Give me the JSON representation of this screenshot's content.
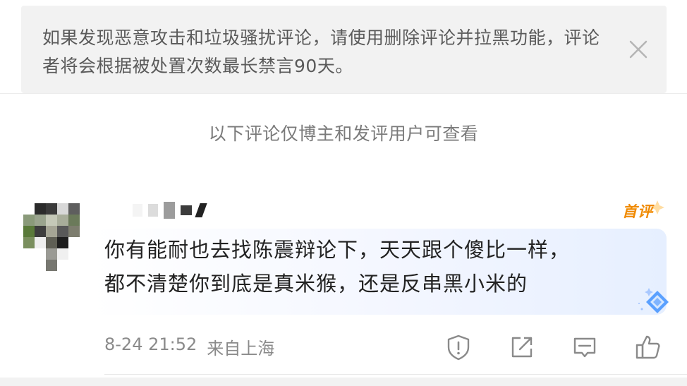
{
  "notice": {
    "text": "如果发现恶意攻击和垃圾骚扰评论，请使用删除评论并拉黑功能，评论者将会根据被处置次数最长禁言90天。",
    "close_icon": "close-icon"
  },
  "visibility_hint": "以下评论仅博主和发评用户可查看",
  "comment": {
    "badge": "首评",
    "text": "你有能耐也去找陈震辩论下，天天跟个傻比一样，\n都不清楚你到底是真米猴，还是反串黑小米的",
    "timestamp": "8-24 21:52",
    "location": "来自上海",
    "actions": [
      "report-icon",
      "share-icon",
      "reply-icon",
      "like-icon"
    ]
  },
  "colors": {
    "accent_orange": "#f08a00",
    "diamond_blue": "#5aa0ff"
  }
}
